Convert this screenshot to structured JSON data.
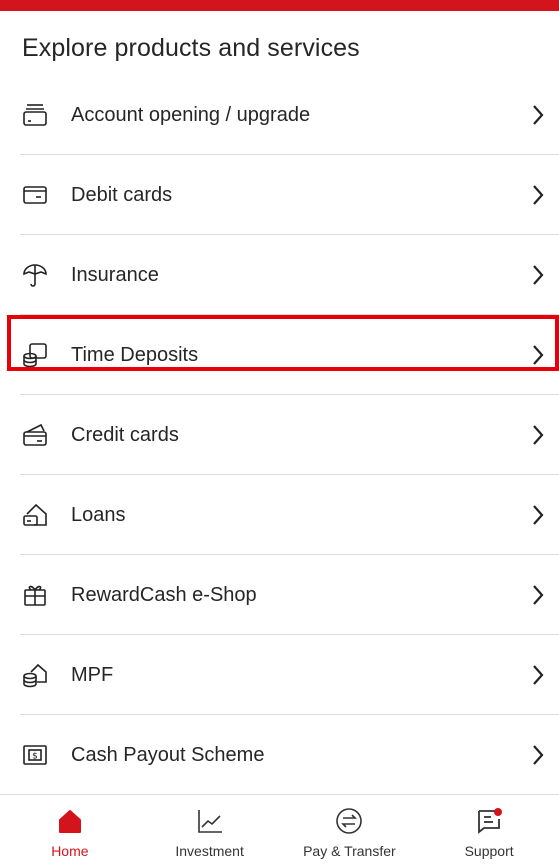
{
  "title": "Explore products and services",
  "items": [
    {
      "label": "Account opening / upgrade",
      "icon": "account-opening-icon"
    },
    {
      "label": "Debit cards",
      "icon": "debit-card-icon"
    },
    {
      "label": "Insurance",
      "icon": "umbrella-icon"
    },
    {
      "label": "Time Deposits",
      "icon": "time-deposit-coins-icon"
    },
    {
      "label": "Credit cards",
      "icon": "credit-card-icon"
    },
    {
      "label": "Loans",
      "icon": "loan-house-icon"
    },
    {
      "label": "RewardCash e-Shop",
      "icon": "gift-icon"
    },
    {
      "label": "MPF",
      "icon": "mpf-coins-house-icon"
    },
    {
      "label": "Cash Payout Scheme",
      "icon": "cash-dollar-icon"
    }
  ],
  "tabs": [
    {
      "label": "Home",
      "icon": "home-icon",
      "active": true
    },
    {
      "label": "Investment",
      "icon": "chart-icon",
      "active": false
    },
    {
      "label": "Pay & Transfer",
      "icon": "transfer-icon",
      "active": false
    },
    {
      "label": "Support",
      "icon": "support-chat-icon",
      "active": false
    }
  ],
  "colors": {
    "brand_red": "#d4141c",
    "highlight": "#e5000a"
  }
}
